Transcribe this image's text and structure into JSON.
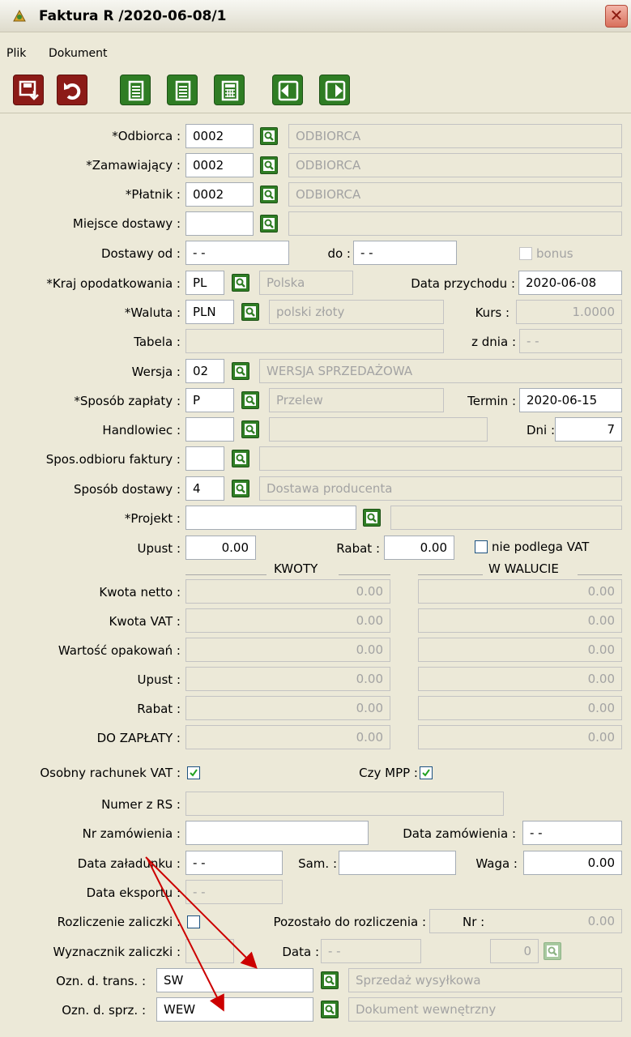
{
  "window": {
    "title": "Faktura R /2020-06-08/1",
    "close_label": "✕"
  },
  "menu": {
    "file": "Plik",
    "document": "Dokument"
  },
  "toolbar": [
    "save-icon",
    "undo-icon",
    "document-icon",
    "document-icon",
    "calculator-icon",
    "exit-left-icon",
    "exit-right-icon"
  ],
  "colors": {
    "accent_green": "#2f7d24",
    "accent_red": "#8c1b17",
    "arrow": "#cc0000"
  },
  "form": {
    "odbiorca": {
      "label": "*Odbiorca :",
      "code": "0002",
      "name": "ODBIORCA"
    },
    "zamawiajacy": {
      "label": "*Zamawiający :",
      "code": "0002",
      "name": "ODBIORCA"
    },
    "platnik": {
      "label": "*Płatnik :",
      "code": "0002",
      "name": "ODBIORCA"
    },
    "miejsce": {
      "label": "Miejsce dostawy :",
      "code": "",
      "name": ""
    },
    "dostawy_od": {
      "label": "Dostawy od :",
      "value": "- -"
    },
    "do": {
      "label": "do :",
      "value": "- -"
    },
    "bonus": {
      "label": "bonus"
    },
    "kraj": {
      "label": "*Kraj opodatkowania :",
      "code": "PL",
      "name": "Polska"
    },
    "data_przychodu": {
      "label": "Data przychodu :",
      "value": "2020-06-08"
    },
    "waluta": {
      "label": "*Waluta :",
      "code": "PLN",
      "name": "polski złoty"
    },
    "kurs": {
      "label": "Kurs :",
      "value": "1.0000"
    },
    "tabela": {
      "label": "Tabela :",
      "value": ""
    },
    "z_dnia": {
      "label": "z dnia :",
      "value": "- -"
    },
    "wersja": {
      "label": "Wersja :",
      "code": "02",
      "name": "WERSJA SPRZEDAŻOWA"
    },
    "sposob_zaplaty": {
      "label": "*Sposób zapłaty :",
      "code": "P",
      "name": "Przelew"
    },
    "termin": {
      "label": "Termin :",
      "value": "2020-06-15"
    },
    "handlowiec": {
      "label": "Handlowiec :",
      "code": "",
      "name": ""
    },
    "dni": {
      "label": "Dni :",
      "value": "7"
    },
    "spos_odbioru": {
      "label": "Spos.odbioru faktury :",
      "code": "",
      "name": ""
    },
    "sposob_dostawy": {
      "label": "Sposób dostawy :",
      "code": "4",
      "name": "Dostawa producenta"
    },
    "projekt": {
      "label": "*Projekt :",
      "code": "",
      "name": ""
    },
    "upust": {
      "label": "Upust :",
      "value": "0.00"
    },
    "rabat": {
      "label": "Rabat :",
      "value": "0.00"
    },
    "nie_podlega_vat": {
      "label": "nie podlega VAT",
      "checked": false
    }
  },
  "amounts": {
    "header_kwoty": "KWOTY",
    "header_waluta": "W WALUCIE",
    "rows": [
      {
        "label": "Kwota netto :",
        "kwoty": "0.00",
        "waluta": "0.00"
      },
      {
        "label": "Kwota VAT :",
        "kwoty": "0.00",
        "waluta": "0.00"
      },
      {
        "label": "Wartość opakowań :",
        "kwoty": "0.00",
        "waluta": "0.00"
      },
      {
        "label": "Upust :",
        "kwoty": "0.00",
        "waluta": "0.00"
      },
      {
        "label": "Rabat :",
        "kwoty": "0.00",
        "waluta": "0.00"
      },
      {
        "label": "DO ZAPŁATY :",
        "kwoty": "0.00",
        "waluta": "0.00"
      }
    ]
  },
  "bottom": {
    "osobny_rachunek": {
      "label": "Osobny rachunek VAT :",
      "checked": true
    },
    "czy_mpp": {
      "label": "Czy MPP :",
      "checked": true
    },
    "numer_rs": {
      "label": "Numer z RS :",
      "value": ""
    },
    "nr_zamowienia": {
      "label": "Nr zamówienia :",
      "value": ""
    },
    "data_zamowienia": {
      "label": "Data zamówienia :",
      "value": "- -"
    },
    "data_zaladunku": {
      "label": "Data załadunku :",
      "value": "- -"
    },
    "sam": {
      "label": "Sam. :",
      "value": ""
    },
    "waga": {
      "label": "Waga :",
      "value": "0.00"
    },
    "data_eksportu": {
      "label": "Data eksportu :",
      "value": "- -"
    },
    "rozliczenie": {
      "label": "Rozliczenie zaliczki :",
      "checked": false
    },
    "pozostalo": {
      "label": "Pozostało do rozliczenia :",
      "nr_label": "Nr :",
      "value": "0.00"
    },
    "wyznacznik": {
      "label": "Wyznacznik zaliczki :",
      "value": ""
    },
    "data": {
      "label": "Data :",
      "value": "- -",
      "num": "0"
    },
    "ozn_trans": {
      "label": "Ozn. d. trans. :",
      "code": "SW",
      "name": "Sprzedaż wysyłkowa"
    },
    "ozn_sprz": {
      "label": "Ozn. d. sprz. :",
      "code": "WEW",
      "name": "Dokument wewnętrzny"
    }
  }
}
